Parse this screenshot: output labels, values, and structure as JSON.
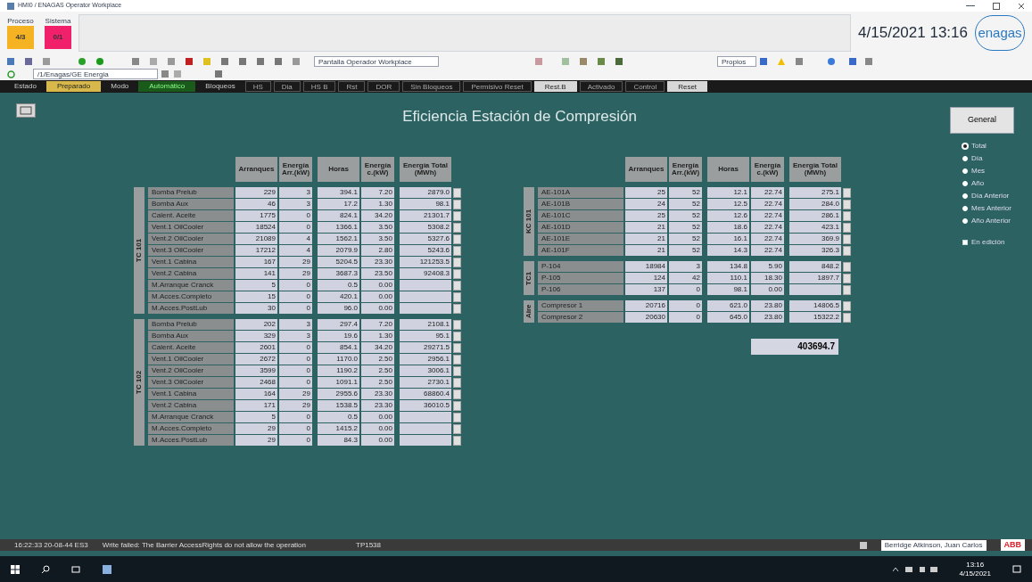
{
  "window": {
    "title": "HMI0 / ENAGAS Operator Workplace"
  },
  "alarm_counters": [
    {
      "label": "Proceso",
      "value": "4/3",
      "color": "#f5b324"
    },
    {
      "label": "Sistema",
      "value": "0/1",
      "color": "#f0206a"
    }
  ],
  "datetime": "4/15/2021 13:16",
  "logo": "enagas",
  "toolbar": {
    "object_field": "Pantalla Operador Workplace",
    "path_field": "/1/Enagas/GE Energia",
    "zoom_field": "Propios"
  },
  "nav_bar": [
    {
      "text": "Estado",
      "kind": "label"
    },
    {
      "text": "Preparado",
      "kind": "state"
    },
    {
      "text": "Modo",
      "kind": "label"
    },
    {
      "text": "Automático",
      "kind": "status"
    },
    {
      "text": "Bloqueos",
      "kind": "label"
    },
    {
      "text": "HS",
      "kind": "cell"
    },
    {
      "text": "Dia",
      "kind": "cell"
    },
    {
      "text": "HS B",
      "kind": "cell"
    },
    {
      "text": "Rst",
      "kind": "cell"
    },
    {
      "text": "DOR",
      "kind": "cell"
    },
    {
      "text": "Sin Bloqueos",
      "kind": "cell"
    },
    {
      "text": "Permisivo Reset",
      "kind": "cell"
    },
    {
      "text": "Rest.B",
      "kind": "button"
    },
    {
      "text": "Activado",
      "kind": "cell"
    },
    {
      "text": "Control",
      "kind": "cell"
    },
    {
      "text": "Reset",
      "kind": "button"
    }
  ],
  "page_title": "Eficiencia Estación de Compresión",
  "general_button": "General",
  "period_options": [
    {
      "label": "Total",
      "selected": true
    },
    {
      "label": "Día",
      "selected": false
    },
    {
      "label": "Mes",
      "selected": false
    },
    {
      "label": "Año",
      "selected": false
    },
    {
      "label": "Día Anterior",
      "selected": false
    },
    {
      "label": "Mes Anterior",
      "selected": false
    },
    {
      "label": "Año Anterior",
      "selected": false
    }
  ],
  "edit_checkbox": {
    "label": "En edición",
    "checked": false
  },
  "left_table": {
    "columns": [
      "Arranques",
      "Energía Arr.(kW)",
      "Horas",
      "Energía c.(kW)",
      "Energía Total (MWh)"
    ],
    "groups": [
      {
        "label": "TC 101",
        "rows": [
          [
            "Bomba Prelub",
            "229",
            "3",
            "394.1",
            "7.20",
            "2879.0"
          ],
          [
            "Bomba Aux",
            "46",
            "3",
            "17.2",
            "1.30",
            "98.1"
          ],
          [
            "Calent. Aceite",
            "1775",
            "0",
            "824.1",
            "34.20",
            "21301.7"
          ],
          [
            "Vent.1 OilCooler",
            "18524",
            "0",
            "1366.1",
            "3.50",
            "5308.2"
          ],
          [
            "Vent.2 OilCooler",
            "21089",
            "4",
            "1562.1",
            "3.50",
            "5327.6"
          ],
          [
            "Vent.3 OilCooler",
            "17212",
            "4",
            "2079.9",
            "2.80",
            "5243.6"
          ],
          [
            "Vent.1 Cabina",
            "167",
            "29",
            "5204.5",
            "23.30",
            "121253.5"
          ],
          [
            "Vent.2 Cabina",
            "141",
            "29",
            "3687.3",
            "23.50",
            "92408.3"
          ],
          [
            "M.Arranque Cranck",
            "5",
            "0",
            "0.5",
            "0.00",
            ""
          ],
          [
            "M.Acces.Completo",
            "15",
            "0",
            "420.1",
            "0.00",
            ""
          ],
          [
            "M.Acces.PostLub",
            "30",
            "0",
            "96.0",
            "0.00",
            ""
          ]
        ]
      },
      {
        "label": "TC 102",
        "rows": [
          [
            "Bomba Prelub",
            "202",
            "3",
            "297.4",
            "7.20",
            "2108.1"
          ],
          [
            "Bomba Aux",
            "329",
            "3",
            "19.6",
            "1.30",
            "95.1"
          ],
          [
            "Calent. Aceite",
            "2601",
            "0",
            "854.1",
            "34.20",
            "29271.5"
          ],
          [
            "Vent.1 OilCooler",
            "2672",
            "0",
            "1170.0",
            "2.50",
            "2956.1"
          ],
          [
            "Vent.2 OilCooler",
            "3599",
            "0",
            "1190.2",
            "2.50",
            "3006.1"
          ],
          [
            "Vent.3 OilCooler",
            "2468",
            "0",
            "1091.1",
            "2.50",
            "2730.1"
          ],
          [
            "Vent.1 Cabina",
            "164",
            "29",
            "2955.6",
            "23.30",
            "68860.4"
          ],
          [
            "Vent.2 Cabina",
            "171",
            "29",
            "1538.5",
            "23.30",
            "36010.5"
          ],
          [
            "M.Arranque Cranck",
            "5",
            "0",
            "0.5",
            "0.00",
            ""
          ],
          [
            "M.Acces.Completo",
            "29",
            "0",
            "1415.2",
            "0.00",
            ""
          ],
          [
            "M.Acces.PostLub",
            "29",
            "0",
            "84.3",
            "0.00",
            ""
          ]
        ]
      }
    ]
  },
  "right_table": {
    "columns": [
      "Arranques",
      "Energía Arr.(kW)",
      "Horas",
      "Energía c.(kW)",
      "Energía Total (MWh)"
    ],
    "groups": [
      {
        "label": "KC 101",
        "rows": [
          [
            "AE-101A",
            "25",
            "52",
            "12.1",
            "22.74",
            "275.1"
          ],
          [
            "AE-101B",
            "24",
            "52",
            "12.5",
            "22.74",
            "284.0"
          ],
          [
            "AE-101C",
            "25",
            "52",
            "12.6",
            "22.74",
            "286.1"
          ],
          [
            "AE-101D",
            "21",
            "52",
            "18.6",
            "22.74",
            "423.1"
          ],
          [
            "AE-101E",
            "21",
            "52",
            "16.1",
            "22.74",
            "369.9"
          ],
          [
            "AE-101F",
            "21",
            "52",
            "14.3",
            "22.74",
            "326.3"
          ]
        ]
      },
      {
        "label": "TC1",
        "rows": [
          [
            "P-104",
            "18984",
            "3",
            "134.8",
            "5.90",
            "848.2"
          ],
          [
            "P-105",
            "124",
            "42",
            "110.1",
            "18.30",
            "1897.7"
          ],
          [
            "P-106",
            "137",
            "0",
            "98.1",
            "0.00",
            ""
          ]
        ]
      },
      {
        "label": "Aire",
        "rows": [
          [
            "Compresor 1",
            "20716",
            "0",
            "621.0",
            "23.80",
            "14806.5"
          ],
          [
            "Compresor 2",
            "20630",
            "0",
            "645.0",
            "23.80",
            "15322.2"
          ]
        ]
      }
    ]
  },
  "grand_total": "403694.7",
  "status_bar": {
    "time": "16:22:33 20-08-44 ES3",
    "message": "Write failed: The Barrier AccessRights do not allow the operation",
    "code": "TP1538",
    "user": "Berridge Atkinson, Juan Carlos",
    "brand": "ABB"
  },
  "taskbar": {
    "time": "13:16",
    "date": "4/15/2021"
  }
}
